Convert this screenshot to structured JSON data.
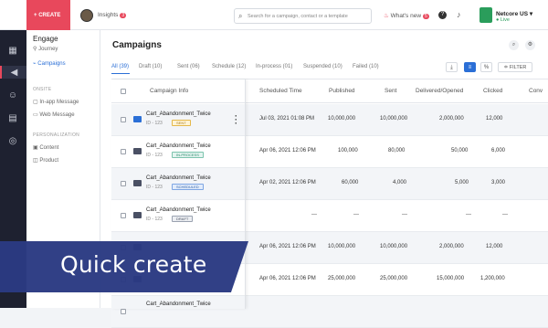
{
  "topbar": {
    "create_label": "CREATE",
    "insights_label": "Insights",
    "insights_badge": "3",
    "search_placeholder": "Search for a campaign, contact or a template",
    "whats_new_label": "What's new",
    "whats_new_badge": "5",
    "help_icon": "?",
    "account_name": "Netcore US",
    "account_status": "Live"
  },
  "sidebar": {
    "title": "Engage",
    "items": [
      {
        "label": "Journey",
        "icon": "journey-icon"
      },
      {
        "label": "Campaigns",
        "icon": "campaigns-icon",
        "active": true
      }
    ],
    "onsite_header": "ONSITE",
    "onsite_items": [
      {
        "label": "In-app Message",
        "icon": "in-app-icon"
      },
      {
        "label": "Web Message",
        "icon": "web-message-icon"
      }
    ],
    "personalization_header": "PERSONALIZATION",
    "personalization_items": [
      {
        "label": "Content",
        "icon": "content-icon"
      },
      {
        "label": "Product",
        "icon": "product-icon"
      }
    ]
  },
  "main": {
    "title": "Campaigns",
    "tabs": [
      {
        "label": "All (39)",
        "active": true
      },
      {
        "label": "Draft (10)"
      },
      {
        "label": "Sent (06)"
      },
      {
        "label": "Schedule (12)"
      },
      {
        "label": "In-process (01)"
      },
      {
        "label": "Suspended (10)"
      },
      {
        "label": "Failed (10)"
      }
    ],
    "filter_label": "FILTER",
    "columns": [
      "Campaign Info",
      "Scheduled Time",
      "Published",
      "Sent",
      "Delivered/Opened",
      "Clicked",
      "Conv"
    ],
    "rows": [
      {
        "name": "Cart_Abandonment_Twice",
        "id": "ID - 123",
        "status": "SENT",
        "time": "Jul 03, 2021 01:08 PM",
        "published": "10,000,000",
        "sent": "10,000,000",
        "delivered": "2,000,000",
        "clicked": "12,000"
      },
      {
        "name": "Cart_Abandonment_Twice",
        "id": "ID - 123",
        "status": "IN-PROCESS",
        "time": "Apr 06, 2021 12:06 PM",
        "published": "100,000",
        "sent": "80,000",
        "delivered": "50,000",
        "clicked": "6,000"
      },
      {
        "name": "Cart_Abandonment_Twice",
        "id": "ID - 123",
        "status": "SCHEDULED",
        "time": "Apr 02, 2021 12:06 PM",
        "published": "60,000",
        "sent": "4,000",
        "delivered": "5,000",
        "clicked": "3,000"
      },
      {
        "name": "Cart_Abandonment_Twice",
        "id": "ID - 123",
        "status": "DRAFT",
        "time": "---",
        "published": "---",
        "sent": "---",
        "delivered": "---",
        "clicked": "---"
      },
      {
        "name": "",
        "id": "",
        "status": "",
        "time": "Apr 06, 2021 12:06 PM",
        "published": "10,000,000",
        "sent": "10,000,000",
        "delivered": "2,000,000",
        "clicked": "12,000"
      },
      {
        "name": "",
        "id": "",
        "status": "",
        "time": "Apr 06, 2021 12:06 PM",
        "published": "25,000,000",
        "sent": "25,000,000",
        "delivered": "15,000,000",
        "clicked": "1,200,000"
      },
      {
        "name": "Cart_Abandonment_Twice",
        "id": "",
        "status": "",
        "time": "",
        "published": "",
        "sent": "",
        "delivered": "",
        "clicked": ""
      }
    ]
  },
  "overlay": {
    "text": "Quick create"
  },
  "colors": {
    "brand": "#e8485c",
    "accent": "#2b6fd6",
    "rail": "#1e2130",
    "overlay": "#2a3a82"
  }
}
